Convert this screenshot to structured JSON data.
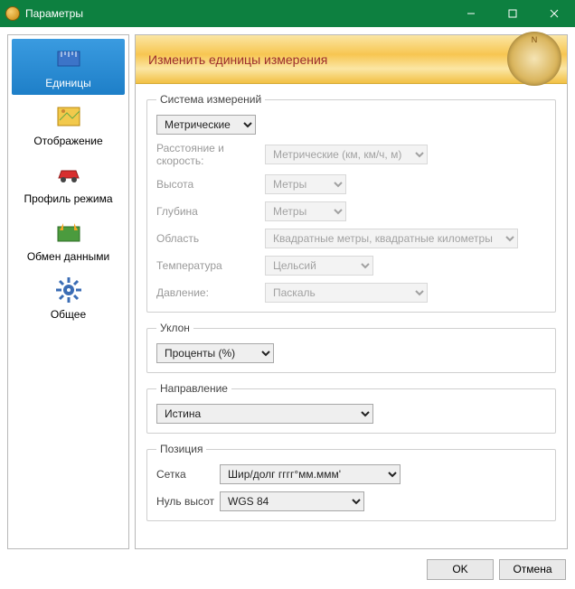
{
  "window": {
    "title": "Параметры"
  },
  "sidebar": {
    "items": [
      {
        "label": "Единицы"
      },
      {
        "label": "Отображение"
      },
      {
        "label": "Профиль режима"
      },
      {
        "label": "Обмен данными"
      },
      {
        "label": "Общее"
      }
    ]
  },
  "banner": {
    "title": "Изменить единицы измерения"
  },
  "groups": {
    "system": {
      "legend": "Система измерений",
      "value": "Метрические",
      "rows": {
        "distance": {
          "label": "Расстояние и скорость:",
          "value": "Метрические (км, км/ч, м)"
        },
        "height": {
          "label": "Высота",
          "value": "Метры"
        },
        "depth": {
          "label": "Глубина",
          "value": "Метры"
        },
        "area": {
          "label": "Область",
          "value": "Квадратные метры, квадратные километры"
        },
        "temp": {
          "label": "Температура",
          "value": "Цельсий"
        },
        "pressure": {
          "label": "Давление:",
          "value": "Паскаль"
        }
      }
    },
    "grade": {
      "legend": "Уклон",
      "value": "Проценты (%)"
    },
    "heading": {
      "legend": "Направление",
      "value": "Истина"
    },
    "position": {
      "legend": "Позиция",
      "grid": {
        "label": "Сетка",
        "value": "Шир/долг гггг°мм.ммм'"
      },
      "datum": {
        "label": "Нуль высот",
        "value": "WGS 84"
      }
    }
  },
  "footer": {
    "ok": "OK",
    "cancel": "Отмена"
  }
}
